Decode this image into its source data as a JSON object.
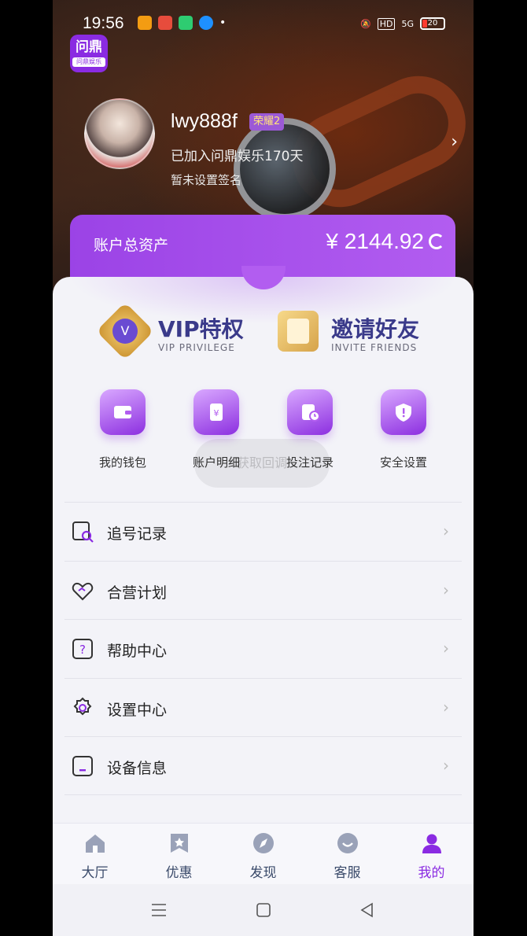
{
  "status_bar": {
    "time": "19:56",
    "network": "HD",
    "signal": "5G",
    "battery": "20",
    "colors": {
      "battery_low": "#ff3b30"
    }
  },
  "logo": {
    "main": "问鼎",
    "sub": "问鼎娱乐"
  },
  "profile": {
    "username": "lwy888f",
    "rank": "荣耀2",
    "joined": "已加入问鼎娱乐170天",
    "signature": "暂未设置签名"
  },
  "assets": {
    "label": "账户总资产",
    "amount": "¥ 2144.92"
  },
  "promos": {
    "vip": {
      "title": "VIP特权",
      "subtitle": "VIP PRIVILEGE"
    },
    "invite": {
      "title": "邀请好友",
      "subtitle": "INVITE FRIENDS"
    }
  },
  "quick_actions": [
    {
      "label": "我的钱包",
      "icon": "wallet-icon"
    },
    {
      "label": "账户明细",
      "icon": "account-detail-icon"
    },
    {
      "label": "投注记录",
      "icon": "bet-record-icon"
    },
    {
      "label": "安全设置",
      "icon": "shield-icon"
    }
  ],
  "toast": "获取回调",
  "menu": [
    {
      "label": "追号记录",
      "icon": "search-record-icon"
    },
    {
      "label": "合营计划",
      "icon": "handshake-icon"
    },
    {
      "label": "帮助中心",
      "icon": "help-icon"
    },
    {
      "label": "设置中心",
      "icon": "gear-icon"
    },
    {
      "label": "设备信息",
      "icon": "device-icon"
    }
  ],
  "tabs": [
    {
      "label": "大厅",
      "icon": "home-icon"
    },
    {
      "label": "优惠",
      "icon": "bookmark-icon"
    },
    {
      "label": "发现",
      "icon": "compass-icon"
    },
    {
      "label": "客服",
      "icon": "chat-icon"
    },
    {
      "label": "我的",
      "icon": "user-icon",
      "active": true
    }
  ],
  "theme": {
    "accent": "#8a2be2",
    "accent_light": "#b25df0"
  }
}
